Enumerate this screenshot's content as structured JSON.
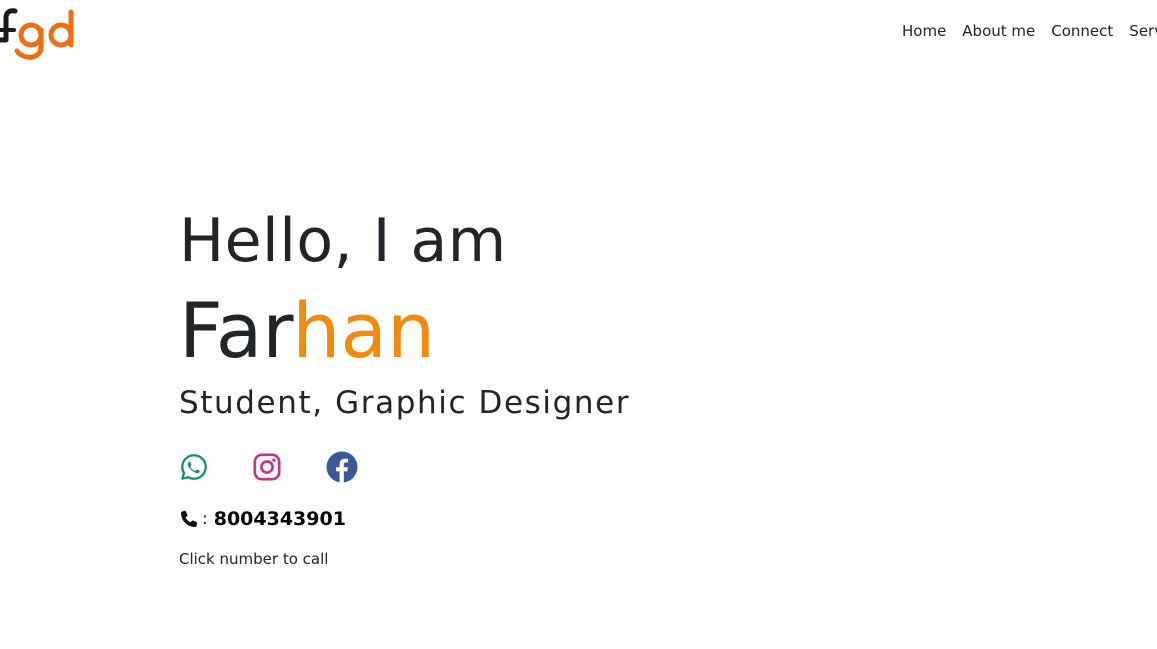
{
  "header": {
    "logo_text": "fgd",
    "nav": [
      "Home",
      "About me",
      "Connect",
      "Serv"
    ]
  },
  "hero": {
    "greeting": "Hello, I am",
    "name_part1": "Far",
    "name_part2": "han",
    "role": "Student, Graphic Designer",
    "phone_separator": ":",
    "phone_number": "8004343901",
    "call_hint": "Click number to call"
  },
  "socials": {
    "whatsapp_icon": "whatsapp-icon",
    "instagram_icon": "instagram-icon",
    "facebook_icon": "facebook-icon",
    "phone_icon": "phone-icon"
  },
  "colors": {
    "accent": "#f18a0f",
    "logo_orange": "#f06d13",
    "text": "#212529",
    "whatsapp": "#128c7e",
    "instagram": "#c13584",
    "facebook": "#3b5998"
  }
}
